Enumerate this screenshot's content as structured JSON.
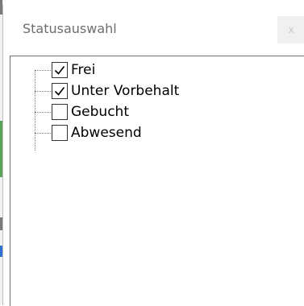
{
  "dialog": {
    "title": "Statusauswahl",
    "close_label": "x"
  },
  "tree": {
    "items": [
      {
        "label": "Frei",
        "checked": true
      },
      {
        "label": "Unter Vorbehalt",
        "checked": true
      },
      {
        "label": "Gebucht",
        "checked": false
      },
      {
        "label": "Abwesend",
        "checked": false
      }
    ]
  },
  "colors": {
    "title_text": "#6d6d6d",
    "border": "#6e6e6e",
    "close_bg": "#f0f0f0",
    "close_text": "#c8c8c8"
  }
}
